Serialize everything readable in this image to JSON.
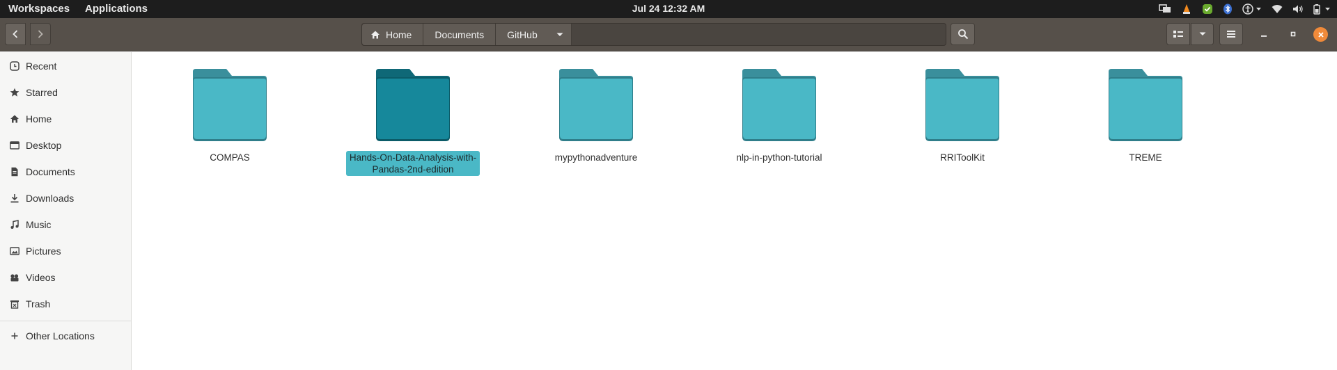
{
  "topbar": {
    "workspaces": "Workspaces",
    "applications": "Applications",
    "clock": "Jul 24  12:32 AM"
  },
  "pathbar": {
    "crumbs": [
      "Home",
      "Documents",
      "GitHub"
    ]
  },
  "sidebar": {
    "items": [
      {
        "label": "Recent",
        "icon": "clock-icon"
      },
      {
        "label": "Starred",
        "icon": "star-icon"
      },
      {
        "label": "Home",
        "icon": "home-icon"
      },
      {
        "label": "Desktop",
        "icon": "desktop-icon"
      },
      {
        "label": "Documents",
        "icon": "document-icon"
      },
      {
        "label": "Downloads",
        "icon": "download-icon"
      },
      {
        "label": "Music",
        "icon": "music-icon"
      },
      {
        "label": "Pictures",
        "icon": "picture-icon"
      },
      {
        "label": "Videos",
        "icon": "video-icon"
      },
      {
        "label": "Trash",
        "icon": "trash-icon"
      }
    ],
    "other_locations": "Other Locations"
  },
  "files": [
    {
      "name": "COMPAS",
      "selected": false
    },
    {
      "name": "Hands-On-Data-Analysis-with-Pandas-2nd-edition",
      "selected": true
    },
    {
      "name": "mypythonadventure",
      "selected": false
    },
    {
      "name": "nlp-in-python-tutorial",
      "selected": false
    },
    {
      "name": "RRIToolKit",
      "selected": false
    },
    {
      "name": "TREME",
      "selected": false
    }
  ],
  "colors": {
    "folder": "#4ab8c6",
    "folder_tab": "#3a8f9c",
    "folder_selected": "#16889b",
    "folder_selected_tab": "#0f6877",
    "close_button": "#f08a3a"
  }
}
